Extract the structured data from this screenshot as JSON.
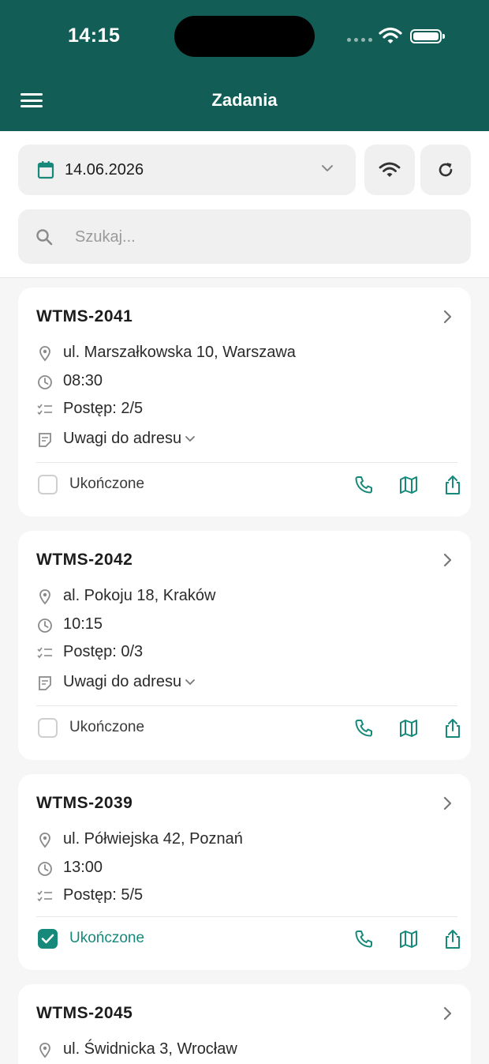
{
  "status_bar": {
    "time": "14:15"
  },
  "header": {
    "title": "Zadania"
  },
  "toolbar": {
    "date": "14.06.2026"
  },
  "search": {
    "placeholder": "Szukaj..."
  },
  "tasks": [
    {
      "id": "WTMS-2041",
      "address": "ul. Marszałkowska 10, Warszawa",
      "time": "08:30",
      "progress": "Postęp: 2/5",
      "notes": "Uwagi do adresu",
      "completed_label": "Ukończone",
      "completed": false
    },
    {
      "id": "WTMS-2042",
      "address": "al. Pokoju 18, Kraków",
      "time": "10:15",
      "progress": "Postęp: 0/3",
      "notes": "Uwagi do adresu",
      "completed_label": "Ukończone",
      "completed": false
    },
    {
      "id": "WTMS-2039",
      "address": "ul. Półwiejska 42, Poznań",
      "time": "13:00",
      "progress": "Postęp: 5/5",
      "completed_label": "Ukończone",
      "completed": true
    },
    {
      "id": "WTMS-2045",
      "address": "ul. Świdnicka 3, Wrocław"
    }
  ],
  "colors": {
    "header_bg": "#125e56",
    "accent": "#16897b"
  },
  "icons": [
    "hamburger-menu-icon",
    "calendar-icon",
    "chevron-down-icon",
    "wifi-icon",
    "refresh-icon",
    "search-icon",
    "chevron-right-icon",
    "location-pin-icon",
    "clock-icon",
    "checklist-icon",
    "note-icon",
    "phone-icon",
    "map-icon",
    "share-icon"
  ]
}
